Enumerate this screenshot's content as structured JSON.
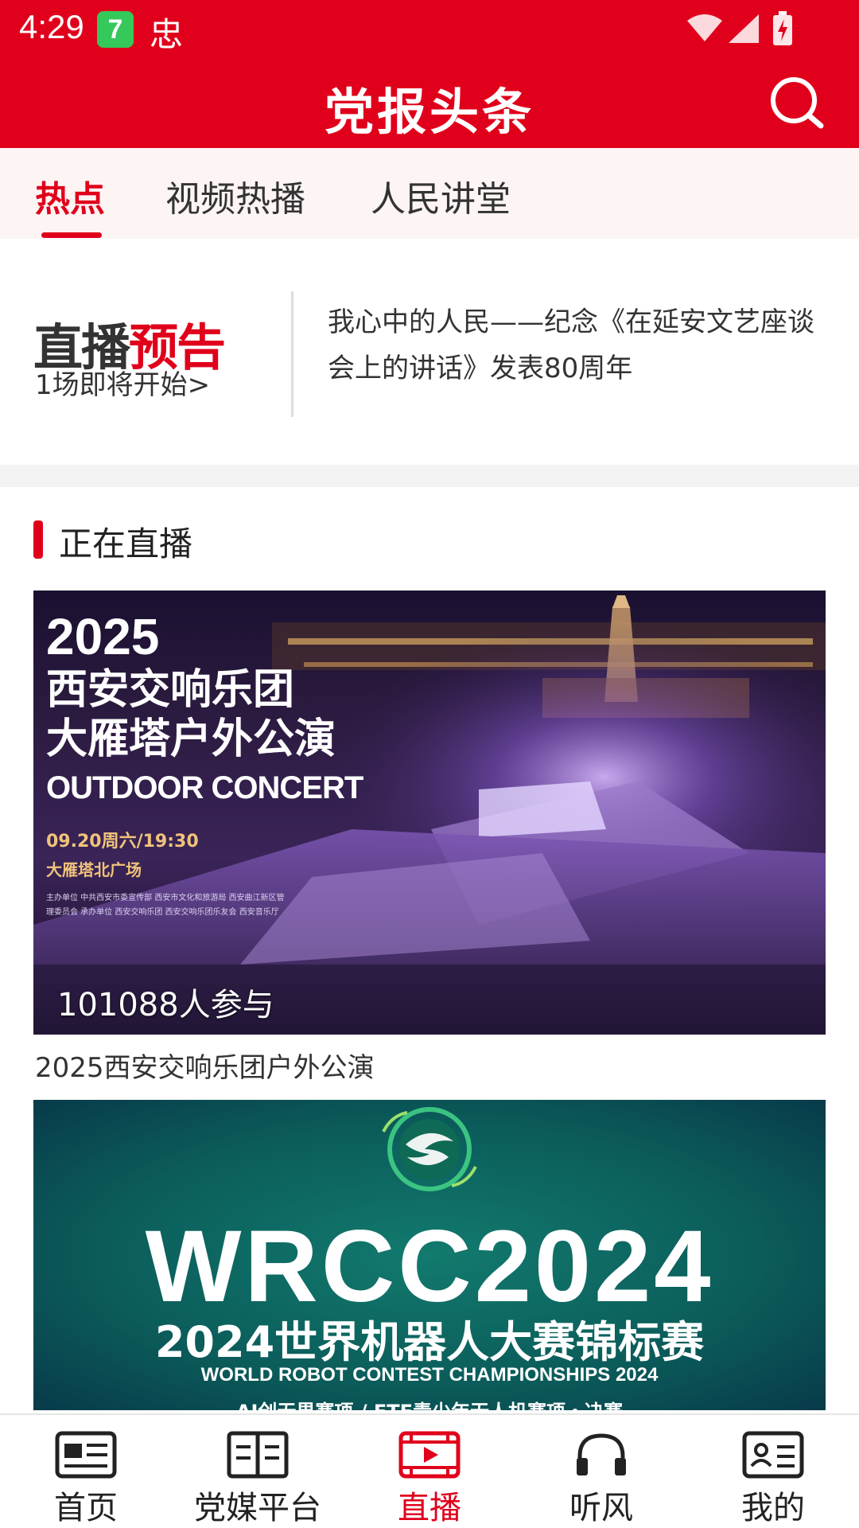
{
  "status_bar": {
    "time": "4:29",
    "app_icon_1": "7",
    "app_icon_2": "忠",
    "icons": [
      "wifi-icon",
      "signal-icon",
      "battery-charging-icon"
    ]
  },
  "app_bar": {
    "title": "党报头条",
    "search_icon": "search-icon"
  },
  "tabs": [
    {
      "label": "热点",
      "active": true
    },
    {
      "label": "视频热播",
      "active": false
    },
    {
      "label": "人民讲堂",
      "active": false
    }
  ],
  "live_preview": {
    "logo_dark": "直播",
    "logo_red": "预告",
    "count_text": "1场即将开始>",
    "headline": "我心中的人民——纪念《在延安文艺座谈会上的讲话》发表80周年"
  },
  "section": {
    "title": "正在直播"
  },
  "live_cards": [
    {
      "poster": {
        "year": "2025",
        "line1": "西安交响乐团",
        "line2": "大雁塔户外公演",
        "english": "OUTDOOR CONCERT",
        "date": "09.20周六/19:30",
        "venue": "大雁塔北广场",
        "small_print": "主办单位 中共西安市委宣传部 西安市文化和旅游局 西安曲江新区管理委员会 承办单位 西安交响乐团 西安交响乐团乐友会 西安音乐厅"
      },
      "participants": "101088人参与",
      "caption": "2025西安交响乐团户外公演"
    },
    {
      "poster": {
        "main": "WRCC2024",
        "cn_title": "2024世界机器人大赛锦标赛",
        "en_title": "WORLD ROBOT CONTEST CHAMPIONSHIPS 2024",
        "sub": "AI创无界赛项 / FTF青少年无人机赛项・决赛"
      }
    }
  ],
  "bottom_nav": [
    {
      "label": "首页",
      "icon": "news-icon",
      "active": false
    },
    {
      "label": "党媒平台",
      "icon": "book-icon",
      "active": false
    },
    {
      "label": "直播",
      "icon": "video-play-icon",
      "active": true
    },
    {
      "label": "听风",
      "icon": "headphones-icon",
      "active": false
    },
    {
      "label": "我的",
      "icon": "profile-card-icon",
      "active": false
    }
  ],
  "colors": {
    "brand_red": "#e0001b",
    "tab_bg": "#fdf4f4",
    "section_gap": "#f3f3f3",
    "nav_inactive": "#222222"
  }
}
